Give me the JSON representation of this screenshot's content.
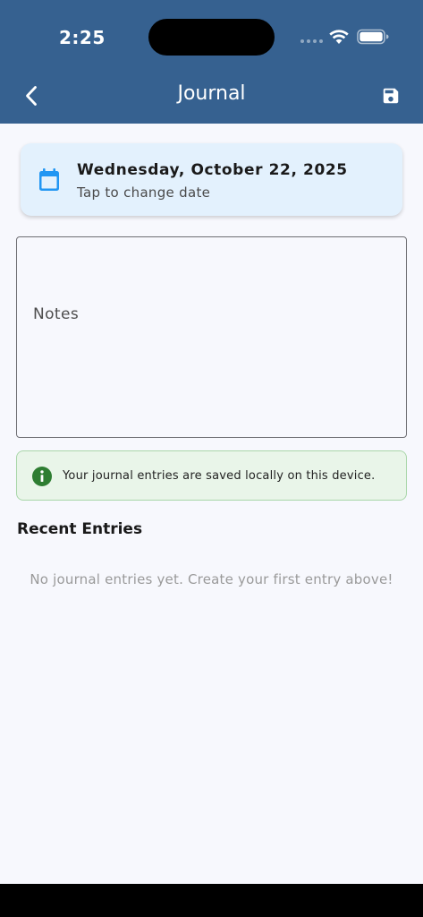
{
  "status_bar": {
    "time": "2:25"
  },
  "header": {
    "title": "Journal",
    "back_icon": "chevron-left-icon",
    "save_icon": "floppy-disk-icon",
    "background": "#366190"
  },
  "date_card": {
    "title": "Wednesday, October 22, 2025",
    "subtitle": "Tap to change date",
    "icon": "calendar-icon",
    "accent": "#2196f3"
  },
  "notes": {
    "label": "Notes",
    "value": ""
  },
  "info_banner": {
    "text": "Your journal entries are saved locally on this device.",
    "icon": "info-icon",
    "accent": "#2e7d32"
  },
  "recent": {
    "title": "Recent Entries",
    "empty_message": "No journal entries yet. Create your first entry above!"
  }
}
